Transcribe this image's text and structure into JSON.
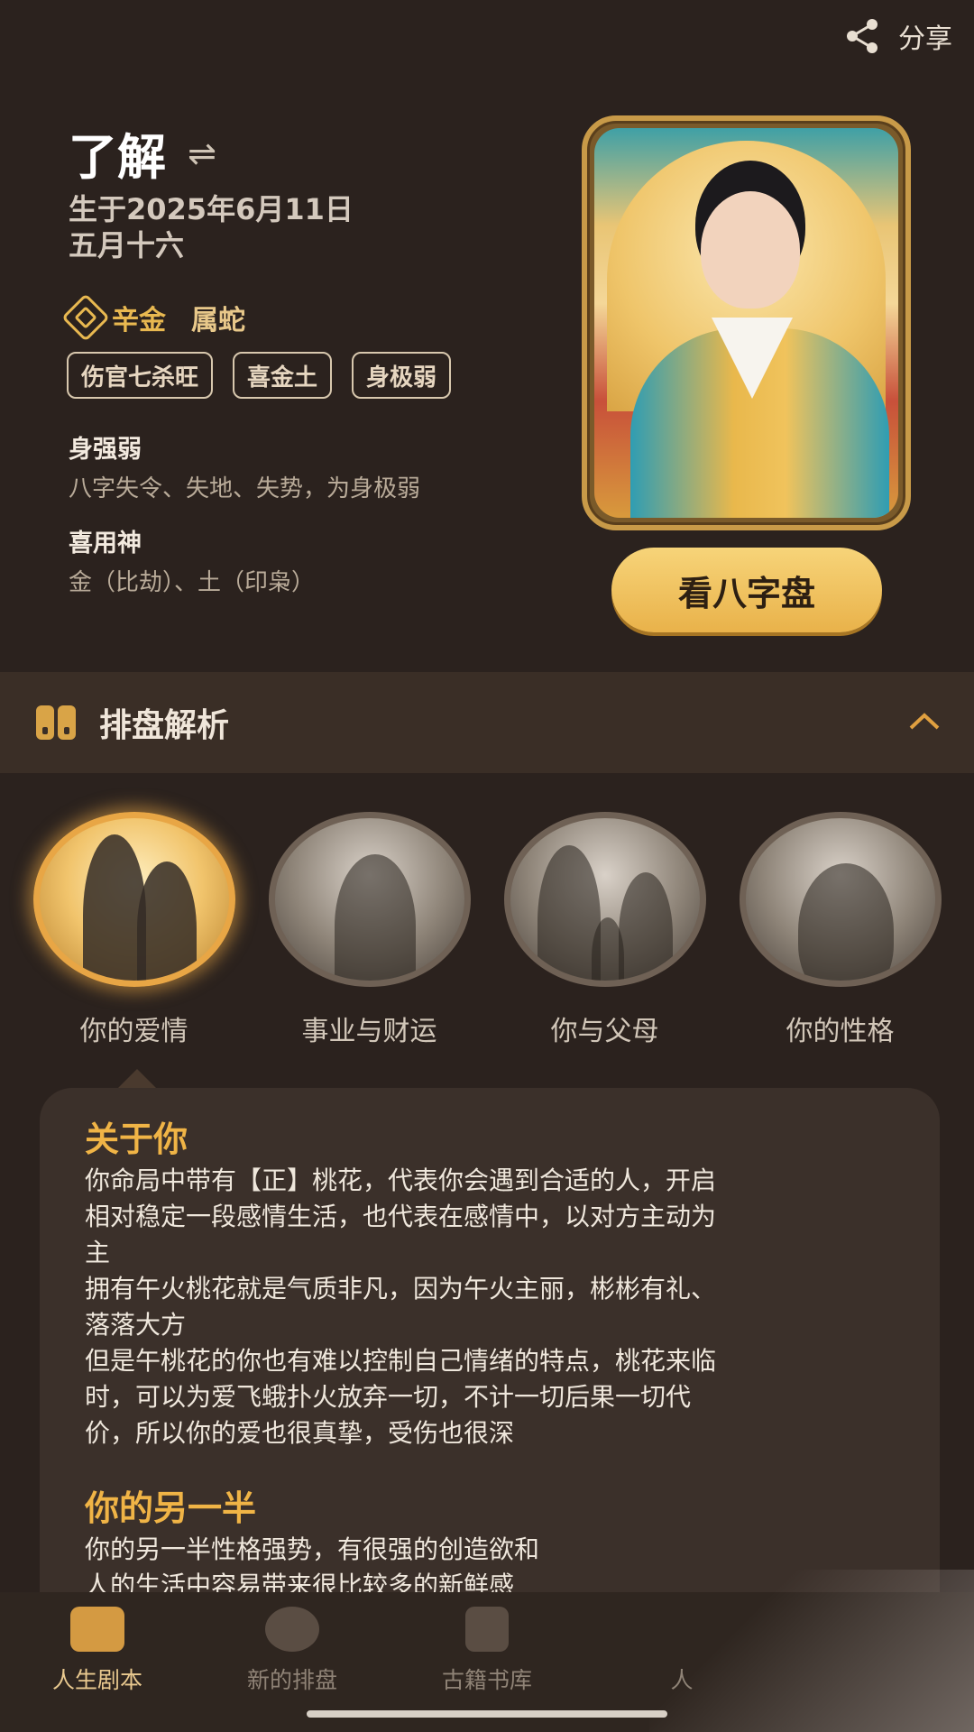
{
  "header": {
    "share_label": "分享"
  },
  "profile": {
    "name": "了解",
    "swap_symbol": "⇌",
    "birth_solar": "生于2025年6月11日",
    "birth_lunar": "五月十六",
    "element": "辛金",
    "zodiac": "属蛇",
    "tags": [
      "伤官七杀旺",
      "喜金土",
      "身极弱"
    ],
    "strength_title": "身强弱",
    "strength_text": "八字失令、失地、失势，为身极弱",
    "favorable_title": "喜用神",
    "favorable_text": "金（比劫）、土（印枭）",
    "view_chart_button": "看八字盘"
  },
  "section": {
    "title": "排盘解析"
  },
  "categories": [
    {
      "label": "你的爱情",
      "active": true
    },
    {
      "label": "事业与财运",
      "active": false
    },
    {
      "label": "你与父母",
      "active": false
    },
    {
      "label": "你的性格",
      "active": false
    }
  ],
  "content": {
    "h1": "关于你",
    "p1": "你命局中带有【正】桃花，代表你会遇到合适的人，开启\n相对稳定一段感情生活，也代表在感情中，以对方主动为\n主\n拥有午火桃花就是气质非凡，因为午火主丽，彬彬有礼、\n落落大方\n但是午桃花的你也有难以控制自己情绪的特点，桃花来临\n时，可以为爱飞蛾扑火放弃一切，不计一切后果一切代\n价，所以你的爱也很真挚，受伤也很深",
    "h2": "你的另一半",
    "p2": "你的另一半性格强势，有很强的创造欲和\n人的生活中容易带来很比较多的新鲜感"
  },
  "bottom_nav": [
    {
      "label": "人生剧本",
      "icon": "script-icon",
      "active": true
    },
    {
      "label": "新的排盘",
      "icon": "compass-icon",
      "active": false
    },
    {
      "label": "古籍书库",
      "icon": "book-icon",
      "active": false
    },
    {
      "label": "人",
      "icon": "profile-icon",
      "active": false
    }
  ],
  "colors": {
    "accent": "#e8b850",
    "background": "#2b221e",
    "card": "#3b302a",
    "heading": "#f0b446"
  }
}
